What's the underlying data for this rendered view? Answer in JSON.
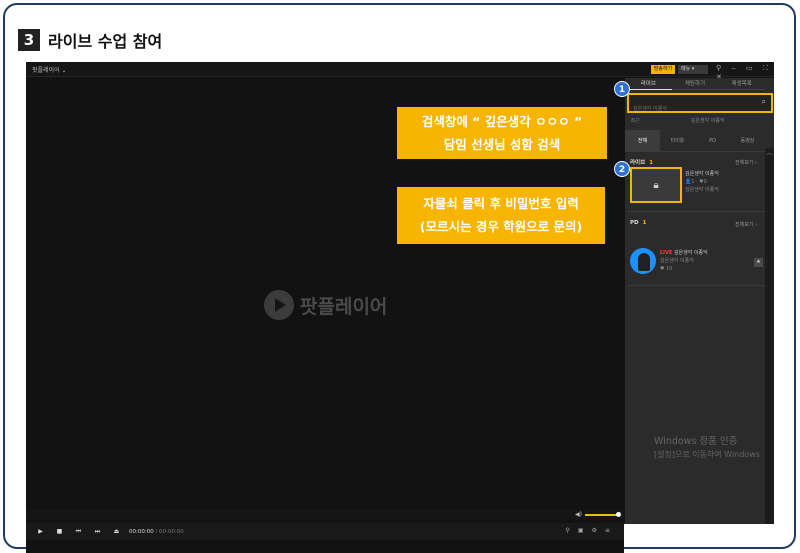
{
  "heading": {
    "number": "3",
    "title": "라이브 수업 참여"
  },
  "titlebar": {
    "app_name": "팟플레이어 ⌄",
    "live_button": "방송하기",
    "menu_button": "메뉴 ▾",
    "window_controls": "⚲ ‒ ▭ ⛶ ✕"
  },
  "video": {
    "logo_text": "팟플레이어"
  },
  "callouts": {
    "search": {
      "line1": "검색창에 “ 깊은생각 ㅇㅇㅇ ”",
      "line2": "담임 선생님 성함 검색"
    },
    "lock": {
      "line1": "자물쇠 클릭 후 비밀번호 입력",
      "line2": "(모르시는 경우 학원으로 문의)"
    }
  },
  "player": {
    "time_current": "00:00:00",
    "time_duration": "/ 00:00:00"
  },
  "panel": {
    "tabs": [
      "라이브",
      "채팅하기",
      "재생목록"
    ],
    "search": {
      "placeholder": "깊은생각 이종익",
      "suggest_label": "최근",
      "suggest_value": "깊은생각 이종익"
    },
    "filters": [
      "전체",
      "타이틀",
      "PD",
      "동영상"
    ],
    "live_section": {
      "title": "라이브",
      "count": "1",
      "more": "전체보기 ›"
    },
    "live_item": {
      "title": "깊은생각 이종익",
      "stats": "👤1 · ♥0",
      "channel": "깊은생각 이종익"
    },
    "pd_section": {
      "title": "PD",
      "count": "1",
      "more": "전체보기 ›"
    },
    "pd_item": {
      "live_tag": "LIVE",
      "title": "깊은생각 이종익",
      "channel": "깊은생각 이종익",
      "fans": "♥ 10"
    }
  },
  "watermark": {
    "line1": "Windows 정품 인증",
    "line2": "[설정]으로 이동하여 Windows"
  },
  "badges": [
    "1",
    "2"
  ]
}
